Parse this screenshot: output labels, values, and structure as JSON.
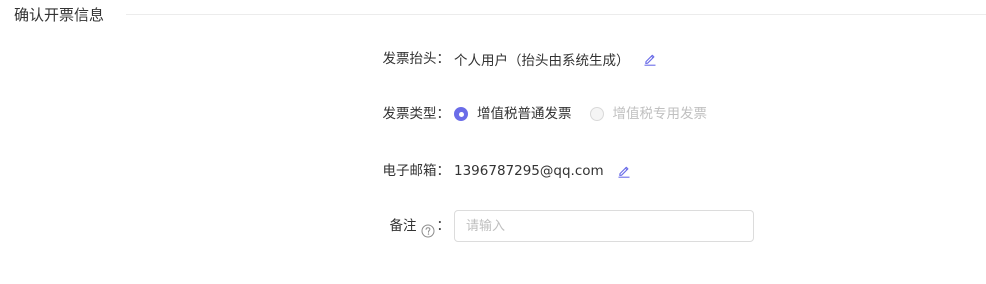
{
  "section": {
    "title": "确认开票信息"
  },
  "form": {
    "invoice_title": {
      "label": "发票抬头",
      "colon": "：",
      "value": "个人用户（抬头由系统生成）",
      "edit_icon": "pencil-edit-icon"
    },
    "invoice_type": {
      "label": "发票类型",
      "colon": "：",
      "options": [
        {
          "label": "增值税普通发票",
          "checked": true,
          "disabled": false
        },
        {
          "label": "增值税专用发票",
          "checked": false,
          "disabled": true
        }
      ]
    },
    "email": {
      "label": "电子邮箱",
      "colon": "：",
      "value": "1396787295@qq.com",
      "edit_icon": "pencil-edit-icon"
    },
    "remark": {
      "label": "备注",
      "colon": "：",
      "help_icon": "question-circle-icon",
      "placeholder": "请输入",
      "value": ""
    }
  },
  "colors": {
    "accent": "#6a6ce8",
    "text": "#333333",
    "disabled_text": "#c0c0c0",
    "divider": "#ececec",
    "input_border": "#dcdcdc",
    "placeholder": "#bfbfbf"
  }
}
